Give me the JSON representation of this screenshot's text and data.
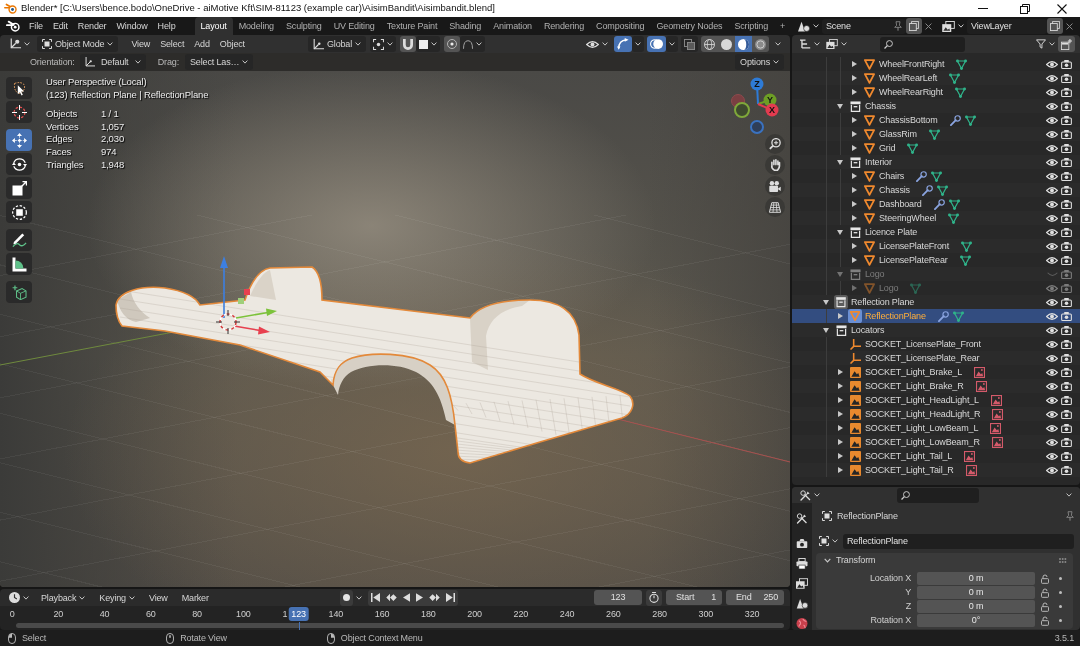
{
  "window": {
    "title": "Blender* [C:\\Users\\bence.bodo\\OneDrive - aiMotive Kft\\SIM-81123 (example car)\\AisimBandit\\Aisimbandit.blend]"
  },
  "topbar": {
    "menus": [
      "File",
      "Edit",
      "Render",
      "Window",
      "Help"
    ],
    "workspaces": [
      {
        "label": "Layout",
        "selected": true
      },
      {
        "label": "Modeling",
        "selected": false
      },
      {
        "label": "Sculpting",
        "selected": false
      },
      {
        "label": "UV Editing",
        "selected": false
      },
      {
        "label": "Texture Paint",
        "selected": false
      },
      {
        "label": "Shading",
        "selected": false
      },
      {
        "label": "Animation",
        "selected": false
      },
      {
        "label": "Rendering",
        "selected": false
      },
      {
        "label": "Compositing",
        "selected": false
      },
      {
        "label": "Geometry Nodes",
        "selected": false
      },
      {
        "label": "Scripting",
        "selected": false
      }
    ],
    "add_workspace": "+",
    "scene": "Scene",
    "view_layer": "ViewLayer"
  },
  "viewport": {
    "mode": "Object Mode",
    "menus": [
      "View",
      "Select",
      "Add",
      "Object"
    ],
    "orientation": "Global",
    "gizmos_on": true,
    "overlays_on": true,
    "xray_on": false,
    "shading": [
      {
        "kind": "wireframe",
        "selected": false
      },
      {
        "kind": "solid",
        "selected": false
      },
      {
        "kind": "material",
        "selected": true
      },
      {
        "kind": "rendered",
        "selected": false
      }
    ],
    "tool_settings": {
      "orientation_label": "Orientation:",
      "orientation": "Default",
      "drag_label": "Drag:",
      "drag": "Select Las…",
      "options": "Options"
    },
    "tool_groups": [
      [
        {
          "kind": "select",
          "selected": false
        },
        {
          "kind": "cursor",
          "selected": false
        }
      ],
      [
        {
          "kind": "move",
          "selected": true
        },
        {
          "kind": "rotate",
          "selected": false
        },
        {
          "kind": "scale",
          "selected": false
        },
        {
          "kind": "transform",
          "selected": false
        }
      ],
      [
        {
          "kind": "annotate",
          "selected": false
        },
        {
          "kind": "measure",
          "selected": false
        }
      ],
      [
        {
          "kind": "add_cube",
          "selected": false
        }
      ]
    ],
    "view_name": "User Perspective (Local)",
    "object_info": "(123) Reflection Plane | ReflectionPlane",
    "stats": [
      {
        "label": "Objects",
        "value": "1 / 1"
      },
      {
        "label": "Vertices",
        "value": "1,057"
      },
      {
        "label": "Edges",
        "value": "2,030"
      },
      {
        "label": "Faces",
        "value": "974"
      },
      {
        "label": "Triangles",
        "value": "1,948"
      }
    ],
    "nav_axes": [
      {
        "label": "Z",
        "color": "#2e7bd6"
      },
      {
        "label": "Y",
        "color": "#6d9e25"
      },
      {
        "label": "X",
        "color": "#e23b4f"
      }
    ]
  },
  "timeline": {
    "menus": [
      {
        "label": "Playback",
        "dropdown": true
      },
      {
        "label": "Keying",
        "dropdown": true
      },
      {
        "label": "View",
        "dropdown": false
      },
      {
        "label": "Marker",
        "dropdown": false
      }
    ],
    "current_frame": "123",
    "start_label": "Start",
    "start": "1",
    "end_label": "End",
    "end": "250",
    "ticks": [
      "0",
      "20",
      "40",
      "60",
      "80",
      "100",
      "1",
      "140",
      "160",
      "180",
      "200",
      "220",
      "240",
      "260",
      "280",
      "300",
      "320"
    ],
    "playhead": {
      "label": "123",
      "level": 0.378
    }
  },
  "outliner": {
    "rows": [
      {
        "children": [
          {
            "children": [
              {
                "label": "WheelFrontRight",
                "kind": "mesh",
                "expanded": false,
                "modifier": false,
                "data": {
                  "kind": "mesh"
                },
                "selected": false,
                "visible": true,
                "disabled": false
              },
              {
                "label": "WheelRearLeft",
                "kind": "mesh",
                "expanded": false,
                "modifier": false,
                "data": {
                  "kind": "mesh"
                },
                "selected": false,
                "visible": true,
                "disabled": false
              },
              {
                "label": "WheelRearRight",
                "kind": "mesh",
                "expanded": false,
                "modifier": false,
                "data": {
                  "kind": "mesh"
                },
                "selected": false,
                "visible": true,
                "disabled": false
              }
            ]
          },
          {
            "label": "Chassis",
            "kind": "collection",
            "expanded": true,
            "active": false,
            "selected": false,
            "visible": true,
            "disabled": false,
            "children": [
              {
                "label": "ChassisBottom",
                "kind": "mesh",
                "expanded": false,
                "modifier": true,
                "data": {
                  "kind": "mesh"
                },
                "selected": false,
                "visible": true,
                "disabled": false
              },
              {
                "label": "GlassRim",
                "kind": "mesh",
                "expanded": false,
                "modifier": false,
                "data": {
                  "kind": "mesh"
                },
                "selected": false,
                "visible": true,
                "disabled": false
              },
              {
                "label": "Grid",
                "kind": "mesh",
                "expanded": false,
                "modifier": false,
                "data": {
                  "kind": "mesh"
                },
                "selected": false,
                "visible": true,
                "disabled": false
              }
            ]
          },
          {
            "label": "Interior",
            "kind": "collection",
            "expanded": true,
            "active": false,
            "selected": false,
            "visible": true,
            "disabled": false,
            "children": [
              {
                "label": "Chairs",
                "kind": "mesh",
                "expanded": false,
                "modifier": true,
                "data": {
                  "kind": "mesh"
                },
                "selected": false,
                "visible": true,
                "disabled": false
              },
              {
                "label": "Chassis",
                "kind": "mesh",
                "expanded": false,
                "modifier": true,
                "data": {
                  "kind": "mesh"
                },
                "selected": false,
                "visible": true,
                "disabled": false
              },
              {
                "label": "Dashboard",
                "kind": "mesh",
                "expanded": false,
                "modifier": true,
                "data": {
                  "kind": "mesh"
                },
                "selected": false,
                "visible": true,
                "disabled": false
              },
              {
                "label": "SteeringWheel",
                "kind": "mesh",
                "expanded": false,
                "modifier": false,
                "data": {
                  "kind": "mesh"
                },
                "selected": false,
                "visible": true,
                "disabled": false
              }
            ]
          },
          {
            "label": "Licence Plate",
            "kind": "collection",
            "expanded": true,
            "active": false,
            "selected": false,
            "visible": true,
            "disabled": false,
            "children": [
              {
                "label": "LicensePlateFront",
                "kind": "mesh",
                "expanded": false,
                "modifier": false,
                "data": {
                  "kind": "mesh"
                },
                "selected": false,
                "visible": true,
                "disabled": false
              },
              {
                "label": "LicensePlateRear",
                "kind": "mesh",
                "expanded": false,
                "modifier": false,
                "data": {
                  "kind": "mesh"
                },
                "selected": false,
                "visible": true,
                "disabled": false
              }
            ]
          },
          {
            "label": "Logo",
            "kind": "collection",
            "expanded": true,
            "active": false,
            "selected": false,
            "visible": false,
            "disabled": true,
            "children": [
              {
                "label": "Logo",
                "kind": "mesh",
                "expanded": false,
                "modifier": false,
                "data": {
                  "kind": "mesh"
                },
                "selected": false,
                "visible": true,
                "disabled": true
              }
            ]
          }
        ]
      },
      {
        "label": "Reflection Plane",
        "kind": "collection",
        "expanded": true,
        "active": true,
        "selected": false,
        "visible": true,
        "disabled": false,
        "children": [
          {
            "label": "ReflectionPlane",
            "kind": "mesh",
            "expanded": false,
            "modifier": true,
            "data": {
              "kind": "mesh"
            },
            "selected": true,
            "visible": true,
            "disabled": false
          }
        ]
      },
      {
        "label": "Locators",
        "kind": "collection",
        "expanded": true,
        "active": false,
        "selected": false,
        "visible": true,
        "disabled": false,
        "children": [
          {
            "label": "SOCKET_LicensePlate_Front",
            "kind": "empty",
            "modifier": false,
            "selected": false,
            "visible": true,
            "disabled": false
          },
          {
            "label": "SOCKET_LicensePlate_Rear",
            "kind": "empty",
            "modifier": false,
            "selected": false,
            "visible": true,
            "disabled": false
          },
          {
            "label": "SOCKET_Light_Brake_L",
            "kind": "image",
            "expanded": false,
            "modifier": false,
            "data": {
              "kind": "image"
            },
            "selected": false,
            "visible": true,
            "disabled": false
          },
          {
            "label": "SOCKET_Light_Brake_R",
            "kind": "image",
            "expanded": false,
            "modifier": false,
            "data": {
              "kind": "image"
            },
            "selected": false,
            "visible": true,
            "disabled": false
          },
          {
            "label": "SOCKET_Light_HeadLight_L",
            "kind": "image",
            "expanded": false,
            "modifier": false,
            "data": {
              "kind": "image"
            },
            "selected": false,
            "visible": true,
            "disabled": false
          },
          {
            "label": "SOCKET_Light_HeadLight_R",
            "kind": "image",
            "expanded": false,
            "modifier": false,
            "data": {
              "kind": "image"
            },
            "selected": false,
            "visible": true,
            "disabled": false
          },
          {
            "label": "SOCKET_Light_LowBeam_L",
            "kind": "image",
            "expanded": false,
            "modifier": false,
            "data": {
              "kind": "image"
            },
            "selected": false,
            "visible": true,
            "disabled": false
          },
          {
            "label": "SOCKET_Light_LowBeam_R",
            "kind": "image",
            "expanded": false,
            "modifier": false,
            "data": {
              "kind": "image"
            },
            "selected": false,
            "visible": true,
            "disabled": false
          },
          {
            "label": "SOCKET_Light_Tail_L",
            "kind": "image",
            "expanded": false,
            "modifier": false,
            "data": {
              "kind": "image"
            },
            "selected": false,
            "visible": true,
            "disabled": false
          },
          {
            "label": "SOCKET_Light_Tail_R",
            "kind": "image",
            "expanded": false,
            "modifier": false,
            "data": {
              "kind": "image"
            },
            "selected": false,
            "visible": true,
            "disabled": false
          }
        ]
      }
    ]
  },
  "properties": {
    "tabs": [
      {
        "kind": "tool",
        "selected": false
      },
      {
        "kind": "render",
        "selected": false
      },
      {
        "kind": "output",
        "selected": false
      },
      {
        "kind": "view_layer",
        "selected": false
      },
      {
        "kind": "scene",
        "selected": false
      },
      {
        "kind": "world",
        "selected": false
      }
    ],
    "object_name": "ReflectionPlane",
    "data_name": "ReflectionPlane",
    "panel": {
      "title": "Transform",
      "expanded": true,
      "fields": [
        {
          "label": "Location X",
          "value": "0 m"
        },
        {
          "label": "Y",
          "value": "0 m"
        },
        {
          "label": "Z",
          "value": "0 m"
        },
        {
          "label": "Rotation X",
          "value": "0°"
        }
      ]
    }
  },
  "status_bar": {
    "hints": [
      "Select",
      "Rotate View",
      "Object Context Menu"
    ],
    "version": "3.5.1"
  }
}
